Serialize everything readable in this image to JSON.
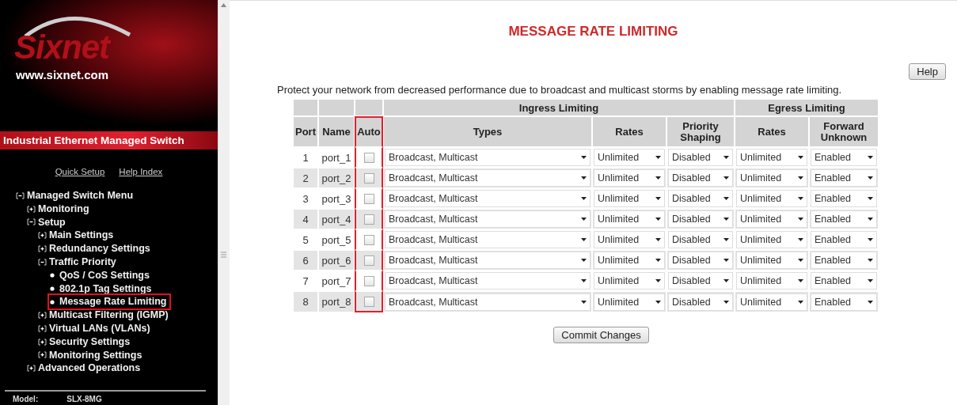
{
  "sidebar": {
    "logo": {
      "brand": "Sixnet",
      "url": "www.sixnet.com"
    },
    "banner": "Industrial Ethernet Managed Switch",
    "links": [
      "Quick Setup",
      "Help Index"
    ],
    "menu": [
      {
        "label": "Managed Switch Menu",
        "kind": "folder",
        "expanded": true,
        "selected": false,
        "children": [
          {
            "label": "Monitoring",
            "kind": "folder",
            "expanded": false,
            "selected": false
          },
          {
            "label": "Setup",
            "kind": "folder",
            "expanded": true,
            "selected": false,
            "children": [
              {
                "label": "Main Settings",
                "kind": "folder",
                "expanded": false,
                "selected": false
              },
              {
                "label": "Redundancy Settings",
                "kind": "folder",
                "expanded": false,
                "selected": false
              },
              {
                "label": "Traffic Priority",
                "kind": "folder",
                "expanded": true,
                "selected": false,
                "children": [
                  {
                    "label": "QoS / CoS Settings",
                    "kind": "page",
                    "selected": false
                  },
                  {
                    "label": "802.1p Tag Settings",
                    "kind": "page",
                    "selected": false
                  },
                  {
                    "label": "Message Rate Limiting",
                    "kind": "page",
                    "selected": true
                  }
                ]
              },
              {
                "label": "Multicast Filtering (IGMP)",
                "kind": "folder",
                "expanded": false,
                "selected": false
              },
              {
                "label": "Virtual LANs (VLANs)",
                "kind": "folder",
                "expanded": false,
                "selected": false
              },
              {
                "label": "Security Settings",
                "kind": "folder",
                "expanded": false,
                "selected": false
              },
              {
                "label": "Monitoring Settings",
                "kind": "folder",
                "expanded": false,
                "selected": false
              }
            ]
          },
          {
            "label": "Advanced Operations",
            "kind": "folder",
            "expanded": false,
            "selected": false
          }
        ]
      }
    ],
    "footer": {
      "label": "Model:",
      "value": "SLX-8MG"
    }
  },
  "page": {
    "title": "MESSAGE RATE LIMITING",
    "help_button": "Help",
    "description": "Protect your network from decreased performance due to broadcast and multicast storms by enabling message rate limiting.",
    "table": {
      "columns": [
        {
          "label": "Port",
          "highlighted": false
        },
        {
          "label": "Name",
          "highlighted": false
        },
        {
          "label": "Auto",
          "highlighted": true
        }
      ],
      "groups": [
        {
          "label": "Ingress Limiting",
          "columns": [
            "Types",
            "Rates",
            "Priority Shaping"
          ]
        },
        {
          "label": "Egress Limiting",
          "columns": [
            "Rates",
            "Forward Unknown"
          ]
        }
      ],
      "rows": [
        {
          "port": "1",
          "name": "port_1",
          "auto": false,
          "values": [
            "Broadcast, Multicast",
            "Unlimited",
            "Disabled",
            "Unlimited",
            "Enabled"
          ]
        },
        {
          "port": "2",
          "name": "port_2",
          "auto": false,
          "values": [
            "Broadcast, Multicast",
            "Unlimited",
            "Disabled",
            "Unlimited",
            "Enabled"
          ]
        },
        {
          "port": "3",
          "name": "port_3",
          "auto": false,
          "values": [
            "Broadcast, Multicast",
            "Unlimited",
            "Disabled",
            "Unlimited",
            "Enabled"
          ]
        },
        {
          "port": "4",
          "name": "port_4",
          "auto": false,
          "values": [
            "Broadcast, Multicast",
            "Unlimited",
            "Disabled",
            "Unlimited",
            "Enabled"
          ]
        },
        {
          "port": "5",
          "name": "port_5",
          "auto": false,
          "values": [
            "Broadcast, Multicast",
            "Unlimited",
            "Disabled",
            "Unlimited",
            "Enabled"
          ]
        },
        {
          "port": "6",
          "name": "port_6",
          "auto": false,
          "values": [
            "Broadcast, Multicast",
            "Unlimited",
            "Disabled",
            "Unlimited",
            "Enabled"
          ]
        },
        {
          "port": "7",
          "name": "port_7",
          "auto": false,
          "values": [
            "Broadcast, Multicast",
            "Unlimited",
            "Disabled",
            "Unlimited",
            "Enabled"
          ]
        },
        {
          "port": "8",
          "name": "port_8",
          "auto": false,
          "values": [
            "Broadcast, Multicast",
            "Unlimited",
            "Disabled",
            "Unlimited",
            "Enabled"
          ]
        }
      ]
    },
    "commit_button": "Commit Changes"
  }
}
